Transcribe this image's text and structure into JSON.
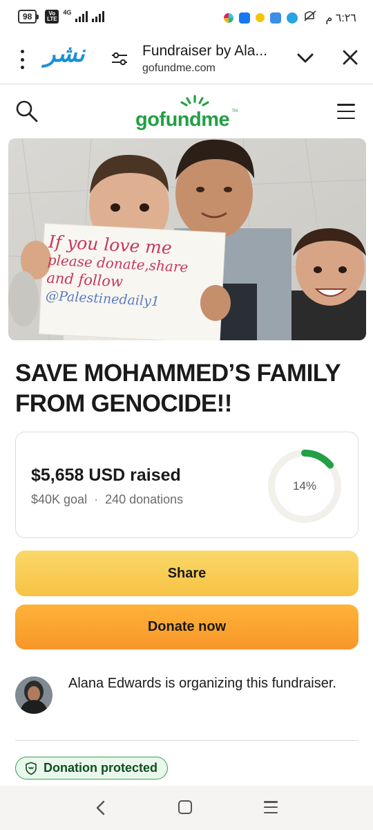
{
  "status_bar": {
    "battery": "98",
    "volte": "Vo LTE",
    "network": "4G",
    "time": "٦:٢٦ م",
    "icons": [
      "slack-icon",
      "messenger-icon",
      "coin-icon",
      "word-icon",
      "telegram-icon",
      "mute-icon"
    ]
  },
  "browser": {
    "app_logo": "نشر",
    "title": "Fundraiser by Ala...",
    "url": "gofundme.com"
  },
  "site": {
    "logo_text": "gofundme",
    "logo_tm": "TM"
  },
  "hero": {
    "sign_line1": "If you love me",
    "sign_line2": "please donate,share",
    "sign_line3": "and follow",
    "sign_line4": "@Palestinedaily1"
  },
  "campaign": {
    "title": "SAVE MOHAMMED’S FAMILY FROM GENOCIDE!!",
    "raised": "$5,658 USD raised",
    "goal": "$40K goal",
    "separator": "·",
    "donations": "240 donations",
    "progress_label": "14%",
    "progress_value": 0.14,
    "accent_color": "#21a044"
  },
  "actions": {
    "share_label": "Share",
    "donate_label": "Donate now"
  },
  "organizer": {
    "text": "Alana Edwards is organizing this fundraiser."
  },
  "badge": {
    "label": "Donation protected"
  }
}
